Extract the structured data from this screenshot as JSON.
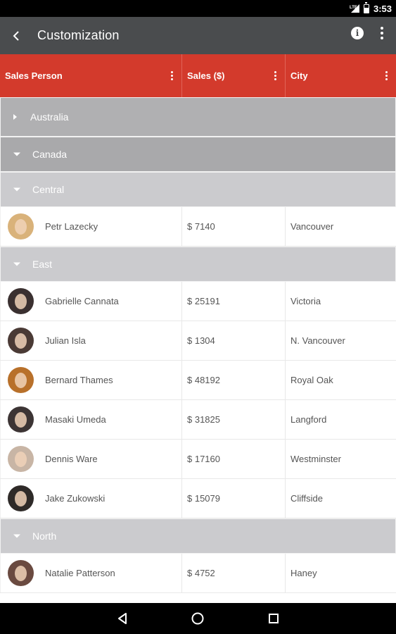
{
  "status_bar": {
    "time": "3:53",
    "network": "LTE"
  },
  "app_bar": {
    "title": "Customization",
    "icons": [
      "back-arrow-icon",
      "info-icon",
      "more-vert-icon"
    ]
  },
  "columns": [
    {
      "label": "Sales Person"
    },
    {
      "label": "Sales ($)"
    },
    {
      "label": "City"
    }
  ],
  "rows": [
    {
      "type": "group",
      "level": 1,
      "label": "Australia",
      "expanded": false
    },
    {
      "type": "group",
      "level": 2,
      "label": "Canada",
      "expanded": true
    },
    {
      "type": "group",
      "level": 3,
      "label": "Central",
      "expanded": true
    },
    {
      "type": "data",
      "name": "Petr Lazecky",
      "sales": "$ 7140",
      "city": "Vancouver",
      "avatar": "#d9b27a"
    },
    {
      "type": "group",
      "level": 3,
      "label": "East",
      "expanded": true
    },
    {
      "type": "data",
      "name": "Gabrielle Cannata",
      "sales": "$ 25191",
      "city": "Victoria",
      "avatar": "#3a3030"
    },
    {
      "type": "data",
      "name": "Julian Isla",
      "sales": "$ 1304",
      "city": "N. Vancouver",
      "avatar": "#4a3a35"
    },
    {
      "type": "data",
      "name": "Bernard Thames",
      "sales": "$ 48192",
      "city": "Royal Oak",
      "avatar": "#b8702a"
    },
    {
      "type": "data",
      "name": "Masaki Umeda",
      "sales": "$ 31825",
      "city": "Langford",
      "avatar": "#3c3434"
    },
    {
      "type": "data",
      "name": "Dennis Ware",
      "sales": "$ 17160",
      "city": "Westminster",
      "avatar": "#c8b5a5"
    },
    {
      "type": "data",
      "name": "Jake Zukowski",
      "sales": "$ 15079",
      "city": "Cliffside",
      "avatar": "#2e2a28"
    },
    {
      "type": "group",
      "level": 3,
      "label": "North",
      "expanded": true
    },
    {
      "type": "data",
      "name": "Natalie Patterson",
      "sales": "$ 4752",
      "city": "Haney",
      "avatar": "#6a4a40"
    }
  ],
  "colors": {
    "app_bar": "#4a4c4e",
    "header": "#d33a2c",
    "group_l1": "#b0b0b2",
    "group_l2": "#a9a9ab",
    "group_l3": "#cbcbce"
  },
  "nav_bar": {
    "icons": [
      "back-triangle-icon",
      "home-circle-icon",
      "recents-square-icon"
    ]
  }
}
